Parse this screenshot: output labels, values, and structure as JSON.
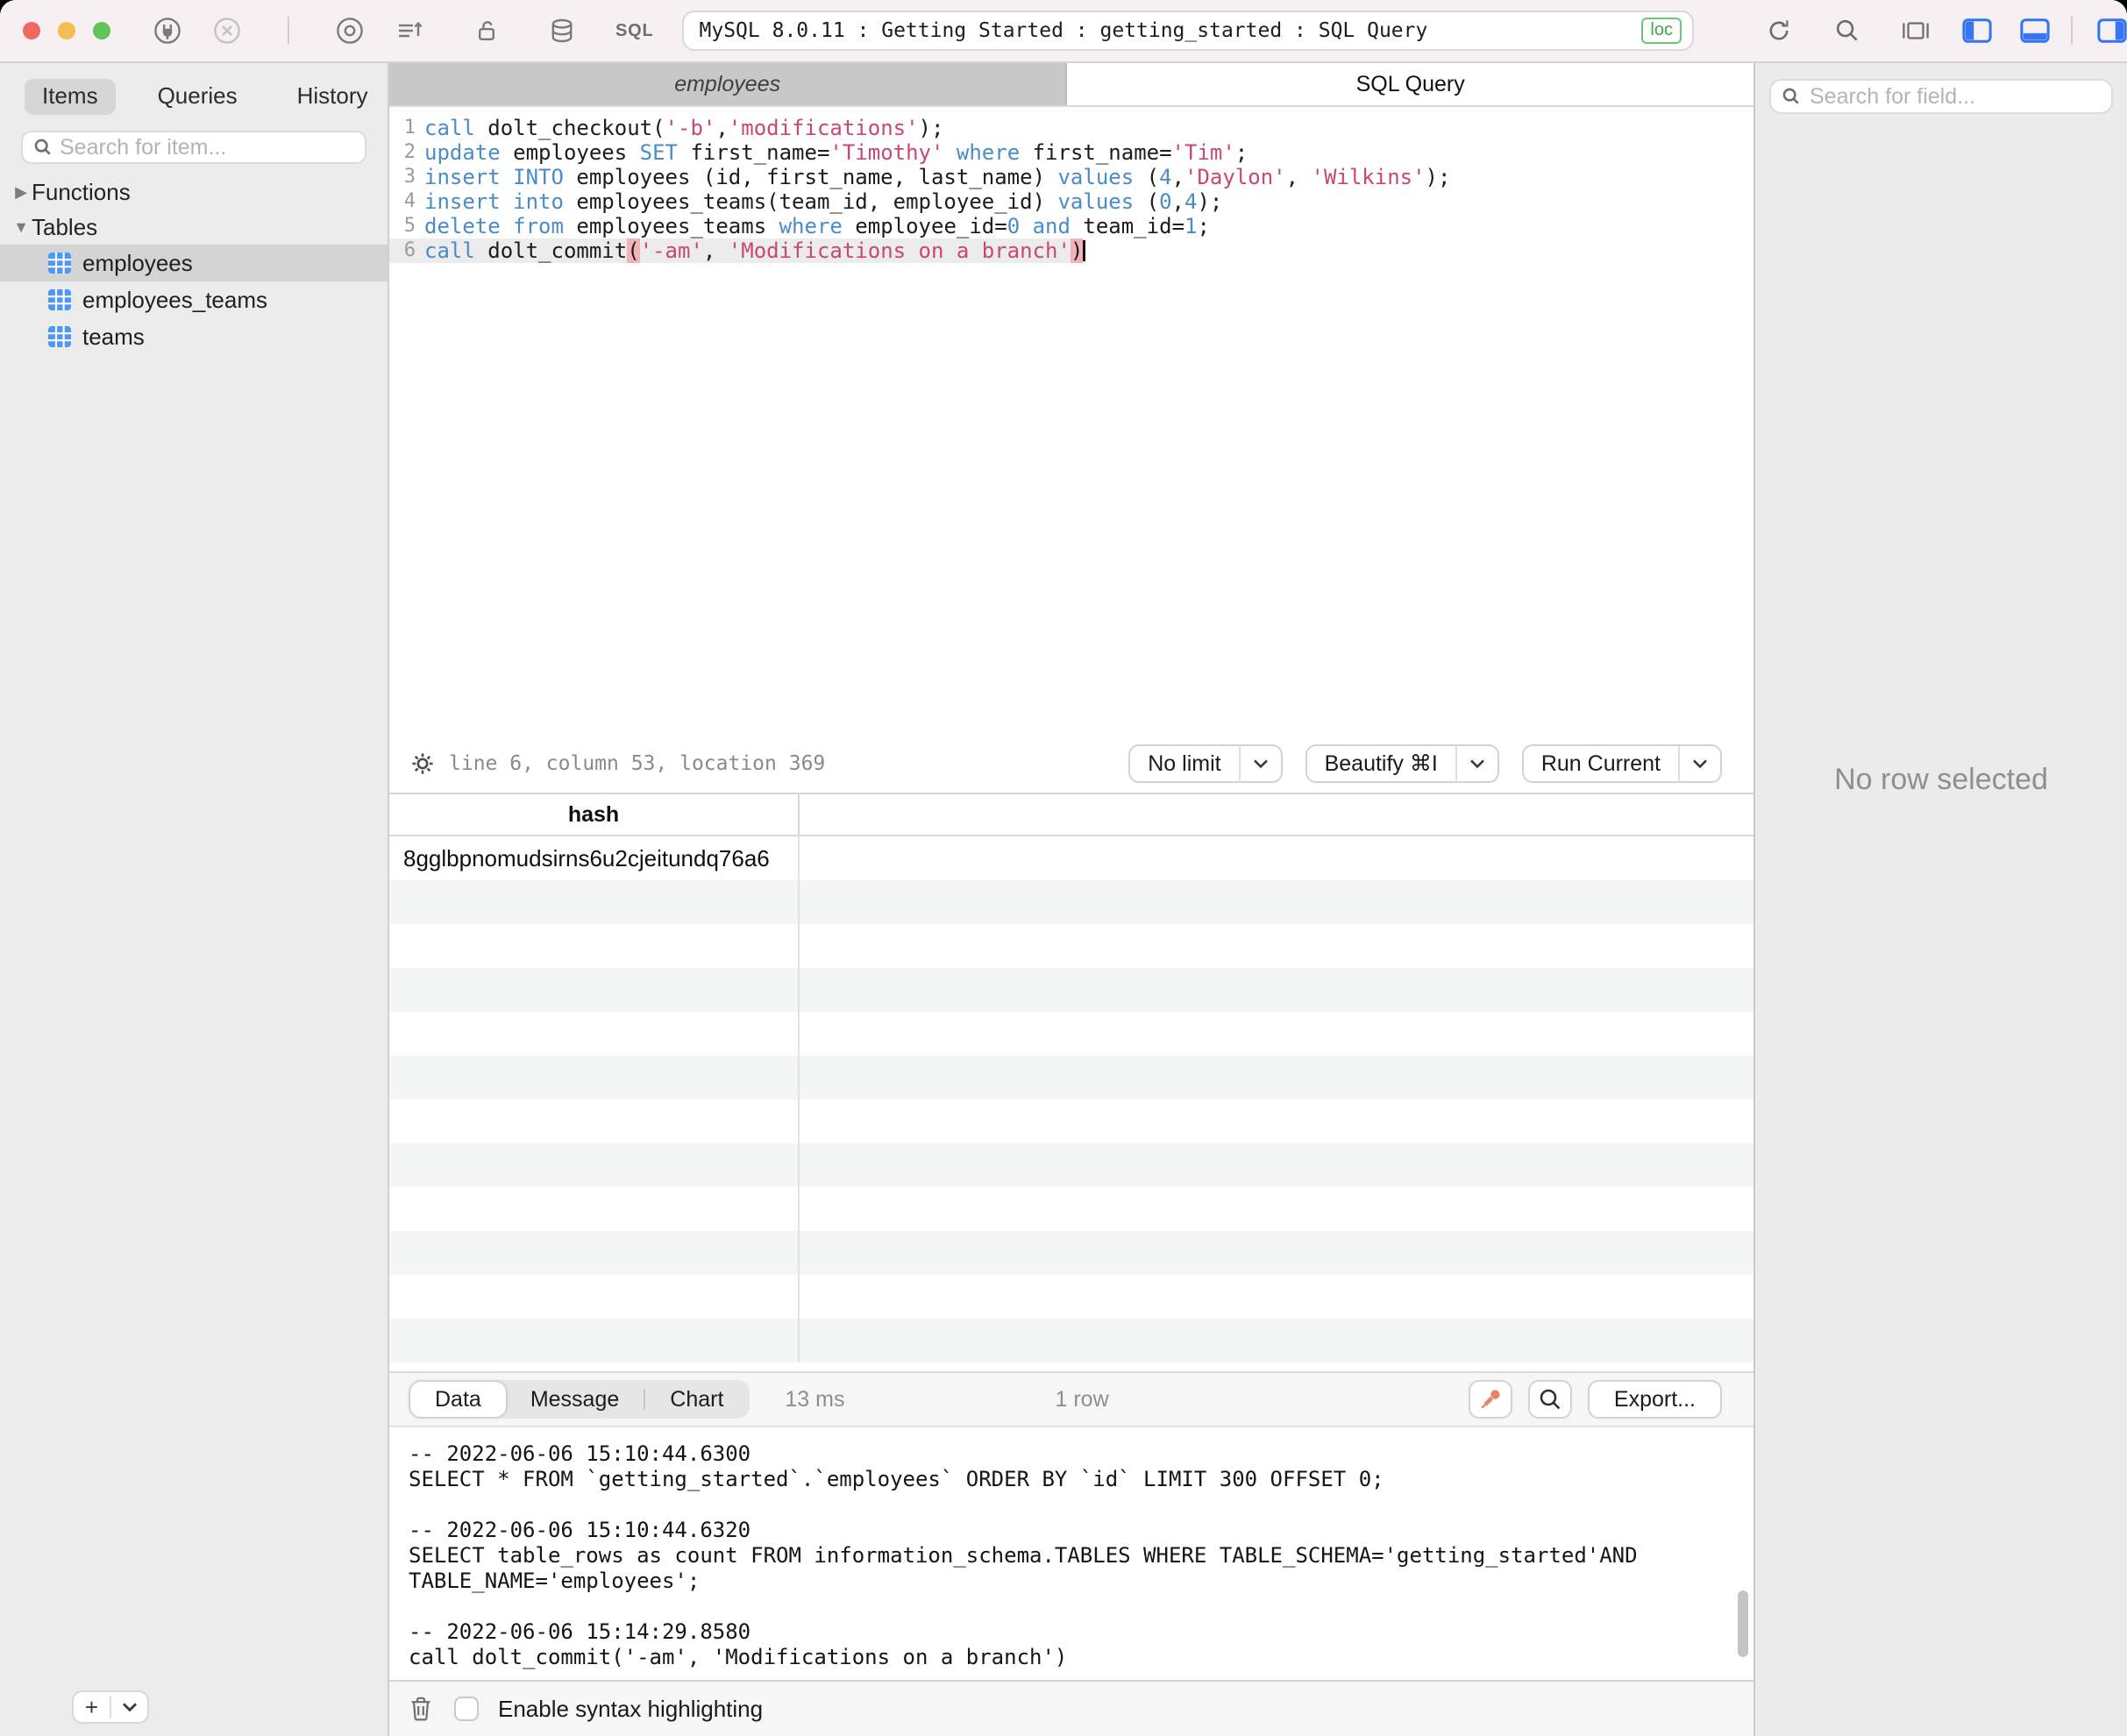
{
  "window": {
    "title": "MySQL 8.0.11 : Getting Started : getting_started : SQL Query",
    "badge": "loc",
    "sql_label": "SQL"
  },
  "colors": {
    "keyword_blue": "#4a8cc9",
    "string_pink": "#c9486e",
    "paren_highlight_bg": "#f2b2b8",
    "panel_toggle_blue": "#3574f2",
    "pin_orange": "#e8846b",
    "loc_badge_green": "#3fa74a",
    "selection_gray": "#d4d4d4",
    "stripe_gray": "#f4f5f5"
  },
  "sidebar": {
    "tabs": [
      {
        "label": "Items",
        "active": true
      },
      {
        "label": "Queries",
        "active": false
      },
      {
        "label": "History",
        "active": false
      }
    ],
    "search_placeholder": "Search for item...",
    "groups": [
      {
        "label": "Functions",
        "collapsed": true
      },
      {
        "label": "Tables",
        "collapsed": false
      }
    ],
    "tables": [
      {
        "label": "employees",
        "selected": true
      },
      {
        "label": "employees_teams",
        "selected": false
      },
      {
        "label": "teams",
        "selected": false
      }
    ],
    "add_label": "+"
  },
  "editor": {
    "tabs": [
      {
        "label": "employees",
        "active": false
      },
      {
        "label": "SQL Query",
        "active": true
      }
    ],
    "lines": [
      {
        "n": 1,
        "tokens": [
          {
            "c": "kw",
            "t": "call"
          },
          {
            "t": " dolt_checkout("
          },
          {
            "c": "str",
            "t": "'-b'"
          },
          {
            "t": ","
          },
          {
            "c": "str",
            "t": "'modifications'"
          },
          {
            "t": ");"
          }
        ]
      },
      {
        "n": 2,
        "tokens": [
          {
            "c": "kw",
            "t": "update"
          },
          {
            "t": " employees "
          },
          {
            "c": "kw",
            "t": "SET"
          },
          {
            "t": " first_name="
          },
          {
            "c": "str",
            "t": "'Timothy'"
          },
          {
            "t": " "
          },
          {
            "c": "kw",
            "t": "where"
          },
          {
            "t": " first_name="
          },
          {
            "c": "str",
            "t": "'Tim'"
          },
          {
            "t": ";"
          }
        ]
      },
      {
        "n": 3,
        "tokens": [
          {
            "c": "kw",
            "t": "insert"
          },
          {
            "t": " "
          },
          {
            "c": "kw",
            "t": "INTO"
          },
          {
            "t": " employees (id, first_name, last_name) "
          },
          {
            "c": "kw",
            "t": "values"
          },
          {
            "t": " ("
          },
          {
            "c": "num",
            "t": "4"
          },
          {
            "t": ","
          },
          {
            "c": "str",
            "t": "'Daylon'"
          },
          {
            "t": ", "
          },
          {
            "c": "str",
            "t": "'Wilkins'"
          },
          {
            "t": ");"
          }
        ]
      },
      {
        "n": 4,
        "tokens": [
          {
            "c": "kw",
            "t": "insert"
          },
          {
            "t": " "
          },
          {
            "c": "kw",
            "t": "into"
          },
          {
            "t": " employees_teams(team_id, employee_id) "
          },
          {
            "c": "kw",
            "t": "values"
          },
          {
            "t": " ("
          },
          {
            "c": "num",
            "t": "0"
          },
          {
            "t": ","
          },
          {
            "c": "num",
            "t": "4"
          },
          {
            "t": ");"
          }
        ]
      },
      {
        "n": 5,
        "tokens": [
          {
            "c": "kw",
            "t": "delete"
          },
          {
            "t": " "
          },
          {
            "c": "kw",
            "t": "from"
          },
          {
            "t": " employees_teams "
          },
          {
            "c": "kw",
            "t": "where"
          },
          {
            "t": " employee_id="
          },
          {
            "c": "num",
            "t": "0"
          },
          {
            "t": " "
          },
          {
            "c": "kw",
            "t": "and"
          },
          {
            "t": " team_id="
          },
          {
            "c": "num",
            "t": "1"
          },
          {
            "t": ";"
          }
        ]
      },
      {
        "n": 6,
        "current": true,
        "tokens": [
          {
            "c": "kw",
            "t": "call"
          },
          {
            "t": " dolt_commit"
          },
          {
            "c": "hl",
            "t": "("
          },
          {
            "c": "str",
            "t": "'-am'"
          },
          {
            "t": ", "
          },
          {
            "c": "str",
            "t": "'Modifications on a branch'"
          },
          {
            "c": "hl",
            "t": ")"
          }
        ]
      }
    ]
  },
  "statusbar": {
    "position": "line 6, column 53, location 369",
    "buttons": [
      {
        "label": "No limit"
      },
      {
        "label": "Beautify ⌘I"
      },
      {
        "label": "Run Current"
      }
    ]
  },
  "results": {
    "columns": [
      "hash"
    ],
    "rows": [
      [
        "8gglbpnomudsirns6u2cjeitundq76a6"
      ]
    ],
    "empty_row_count": 12
  },
  "results_toolbar": {
    "tabs": [
      {
        "label": "Data",
        "active": true
      },
      {
        "label": "Message",
        "active": false
      },
      {
        "label": "Chart",
        "active": false
      }
    ],
    "duration": "13 ms",
    "row_count": "1 row",
    "export_label": "Export..."
  },
  "console": {
    "lines": [
      "-- 2022-06-06 15:10:44.6300",
      "SELECT * FROM `getting_started`.`employees` ORDER BY `id` LIMIT 300 OFFSET 0;",
      "",
      "-- 2022-06-06 15:10:44.6320",
      "SELECT table_rows as count FROM information_schema.TABLES WHERE TABLE_SCHEMA='getting_started'AND",
      "TABLE_NAME='employees';",
      "",
      "-- 2022-06-06 15:14:29.8580",
      "call dolt_commit('-am', 'Modifications on a branch')"
    ]
  },
  "bottombar": {
    "checkbox_label": "Enable syntax highlighting",
    "checked": false
  },
  "right_panel": {
    "search_placeholder": "Search for field...",
    "empty_message": "No row selected"
  }
}
